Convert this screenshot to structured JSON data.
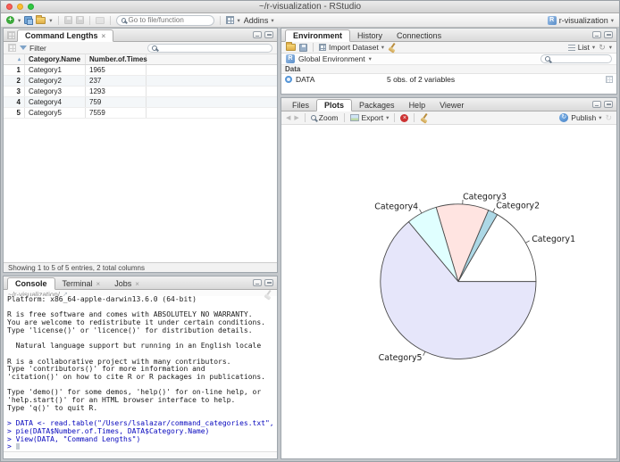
{
  "window": {
    "title": "~/r-visualization - RStudio",
    "project_button": "r-visualization"
  },
  "main_toolbar": {
    "goto_placeholder": "Go to file/function",
    "addins_label": "Addins"
  },
  "data_viewer": {
    "tab_title": "Command Lengths",
    "filter_button": "Filter",
    "columns": [
      "Category.Name",
      "Number.of.Times"
    ],
    "rows": [
      [
        "1",
        "Category1",
        "1965"
      ],
      [
        "2",
        "Category2",
        "237"
      ],
      [
        "3",
        "Category3",
        "1293"
      ],
      [
        "4",
        "Category4",
        "759"
      ],
      [
        "5",
        "Category5",
        "7559"
      ]
    ],
    "status": "Showing 1 to 5 of 5 entries, 2 total columns"
  },
  "console_pane": {
    "tabs": [
      "Console",
      "Terminal",
      "Jobs"
    ],
    "working_dir": "~/r-visualization/",
    "lines": [
      {
        "kind": "output",
        "text": "Platform: x86_64-apple-darwin13.6.0 (64-bit)"
      },
      {
        "kind": "output",
        "text": ""
      },
      {
        "kind": "output",
        "text": "R is free software and comes with ABSOLUTELY NO WARRANTY."
      },
      {
        "kind": "output",
        "text": "You are welcome to redistribute it under certain conditions."
      },
      {
        "kind": "output",
        "text": "Type 'license()' or 'licence()' for distribution details."
      },
      {
        "kind": "output",
        "text": ""
      },
      {
        "kind": "output",
        "text": "  Natural language support but running in an English locale"
      },
      {
        "kind": "output",
        "text": ""
      },
      {
        "kind": "output",
        "text": "R is a collaborative project with many contributors."
      },
      {
        "kind": "output",
        "text": "Type 'contributors()' for more information and"
      },
      {
        "kind": "output",
        "text": "'citation()' on how to cite R or R packages in publications."
      },
      {
        "kind": "output",
        "text": ""
      },
      {
        "kind": "output",
        "text": "Type 'demo()' for some demos, 'help()' for on-line help, or"
      },
      {
        "kind": "output",
        "text": "'help.start()' for an HTML browser interface to help."
      },
      {
        "kind": "output",
        "text": "Type 'q()' to quit R."
      },
      {
        "kind": "output",
        "text": ""
      },
      {
        "kind": "command",
        "text": "> DATA <- read.table(\"/Users/lsalazar/command_categories.txt\", header=TRUE)"
      },
      {
        "kind": "command",
        "text": "> pie(DATA$Number.of.Times, DATA$Category.Name)"
      },
      {
        "kind": "command",
        "text": "> View(DATA, \"Command Lengths\")"
      },
      {
        "kind": "command",
        "text": "> "
      }
    ]
  },
  "environment_pane": {
    "tabs": [
      "Environment",
      "History",
      "Connections"
    ],
    "import_dataset_button": "Import Dataset",
    "list_button": "List",
    "scope_selector": "Global Environment",
    "section_label": "Data",
    "objects": [
      {
        "name": "DATA",
        "summary": "5 obs. of 2 variables"
      }
    ]
  },
  "plots_pane": {
    "tabs": [
      "Files",
      "Plots",
      "Packages",
      "Help",
      "Viewer"
    ],
    "zoom_button": "Zoom",
    "export_button": "Export",
    "publish_button": "Publish"
  },
  "colors": {
    "console_command_text": "#0606bd",
    "publish_accent": "#3f7cc2",
    "traffic_red": "#f95f57",
    "traffic_yellow": "#fbbe2e",
    "traffic_green": "#30c842"
  },
  "chart_data": {
    "type": "pie",
    "title": "",
    "categories": [
      "Category1",
      "Category2",
      "Category3",
      "Category4",
      "Category5"
    ],
    "values": [
      1965,
      237,
      1293,
      759,
      7559
    ],
    "colors": [
      "#FFFFFF",
      "#ADD8E6",
      "#FFE4E1",
      "#E0FFFF",
      "#E6E6FA"
    ],
    "start_angle_deg": 0,
    "direction": "counterclockwise",
    "border_color": "#4a4a4a",
    "legend_position": "none"
  }
}
